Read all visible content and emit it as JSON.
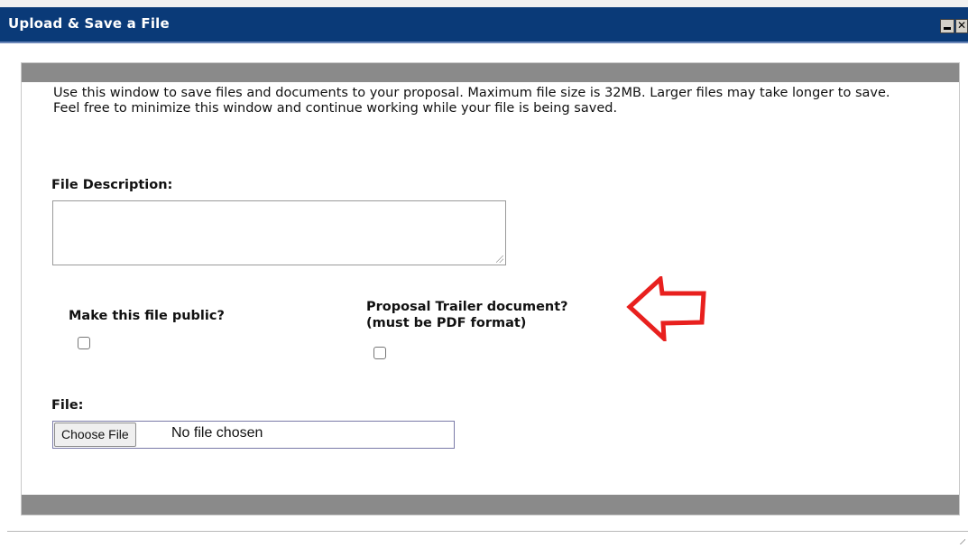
{
  "window": {
    "title": "Upload & Save a File",
    "minimize_icon": "minimize-icon",
    "close_glyph": "✕"
  },
  "form": {
    "intro": "Use this window to save files and documents to your proposal. Maximum file size is 32MB. Larger files may take longer to save. Feel free to minimize this window and continue working while your file is being saved.",
    "description_label": "File Description:",
    "description_value": "",
    "public_label": "Make this file public?",
    "public_checked": false,
    "trailer_label_line1": "Proposal Trailer document?",
    "trailer_label_line2": "(must be PDF format)",
    "trailer_checked": false,
    "file_label": "File:",
    "choose_button": "Choose File",
    "no_file_text": "No file chosen"
  },
  "annotation": {
    "icon": "red-outline-left-arrow-icon",
    "color": "#e8201e"
  },
  "colors": {
    "titlebar": "#0a3a78",
    "bar": "#8a8a8a"
  }
}
